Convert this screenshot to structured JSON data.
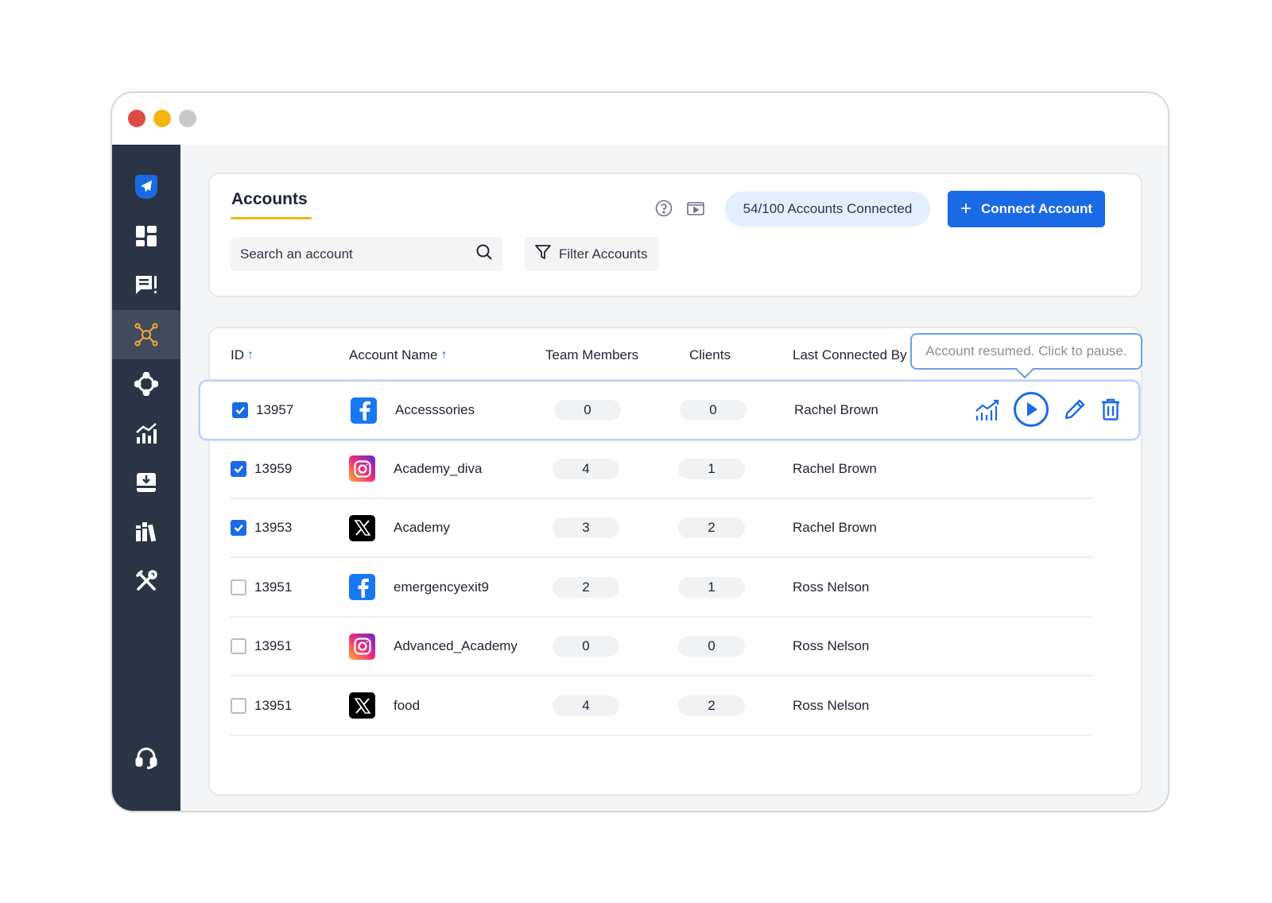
{
  "page": {
    "title": "Accounts",
    "accounts_connected": "54/100 Accounts Connected",
    "connect_button": "Connect Account",
    "search_placeholder": "Search an account",
    "filter_label": "Filter Accounts"
  },
  "sidebar": {
    "items": [
      {
        "icon": "send-logo-icon"
      },
      {
        "icon": "dashboard-icon"
      },
      {
        "icon": "posts-icon"
      },
      {
        "icon": "network-icon",
        "active": true
      },
      {
        "icon": "connections-icon"
      },
      {
        "icon": "analytics-icon"
      },
      {
        "icon": "inbox-icon"
      },
      {
        "icon": "library-icon"
      },
      {
        "icon": "tools-icon"
      },
      {
        "icon": "support-icon"
      }
    ]
  },
  "table": {
    "headers": {
      "id": "ID",
      "account_name": "Account Name",
      "team_members": "Team Members",
      "clients": "Clients",
      "last_connected_by": "Last Connected By"
    },
    "rows": [
      {
        "checked": true,
        "id": "13957",
        "network": "facebook",
        "name": "Accesssories",
        "team": "0",
        "clients": "0",
        "by": "Rachel Brown"
      },
      {
        "checked": true,
        "id": "13959",
        "network": "instagram",
        "name": "Academy_diva",
        "team": "4",
        "clients": "1",
        "by": "Rachel Brown"
      },
      {
        "checked": true,
        "id": "13953",
        "network": "x",
        "name": "Academy",
        "team": "3",
        "clients": "2",
        "by": "Rachel Brown"
      },
      {
        "checked": false,
        "id": "13951",
        "network": "facebook",
        "name": "emergencyexit9",
        "team": "2",
        "clients": "1",
        "by": "Ross Nelson"
      },
      {
        "checked": false,
        "id": "13951",
        "network": "instagram",
        "name": "Advanced_Academy",
        "team": "0",
        "clients": "0",
        "by": "Ross Nelson"
      },
      {
        "checked": false,
        "id": "13951",
        "network": "x",
        "name": "food",
        "team": "4",
        "clients": "2",
        "by": "Ross Nelson"
      }
    ]
  },
  "tooltip": {
    "text": "Account resumed. Click to pause."
  },
  "colors": {
    "accent": "#1a6ae6",
    "sidebar": "#2b3444",
    "tab_underline": "#f2b21b"
  }
}
